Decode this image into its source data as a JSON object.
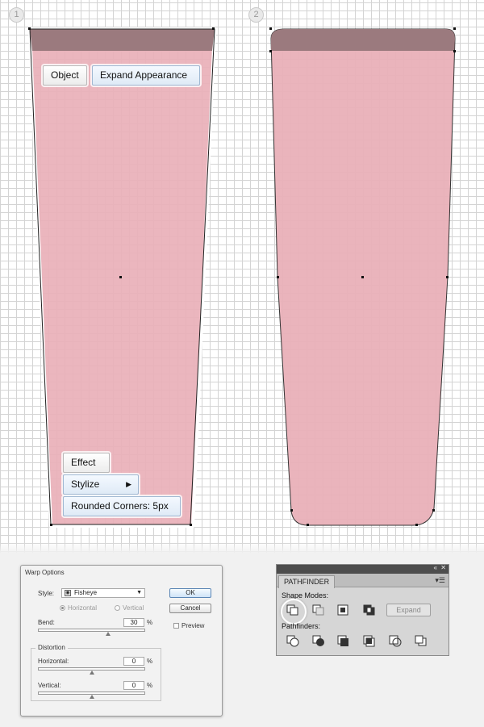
{
  "step_numbers": [
    "1",
    "2"
  ],
  "step1": {
    "object_label": "Object",
    "expand_appearance_label": "Expand Appearance",
    "effect_label": "Effect",
    "stylize_label": "Stylize",
    "rounded_corners_label": "Rounded Corners: 5px"
  },
  "warp_dialog": {
    "title": "Warp Options",
    "style_label": "Style:",
    "style_value": "Fisheye",
    "horizontal_label": "Horizontal",
    "vertical_label": "Vertical",
    "bend_label": "Bend:",
    "bend_value": "30",
    "percent": "%",
    "distortion_label": "Distortion",
    "dist_horizontal_label": "Horizontal:",
    "dist_horizontal_value": "0",
    "dist_vertical_label": "Vertical:",
    "dist_vertical_value": "0",
    "ok_label": "OK",
    "cancel_label": "Cancel",
    "preview_label": "Preview"
  },
  "pathfinder": {
    "tab_label": "PATHFINDER",
    "shape_modes_label": "Shape Modes:",
    "pathfinders_label": "Pathfinders:",
    "expand_label": "Expand",
    "collapse_icon": "«",
    "close_icon": "✕",
    "menu_icon": "▾☰"
  },
  "colors": {
    "shape_fill": "#e9b0b8",
    "shape_top": "#9b7a7e",
    "accent_blue": "#4a8fd6"
  }
}
